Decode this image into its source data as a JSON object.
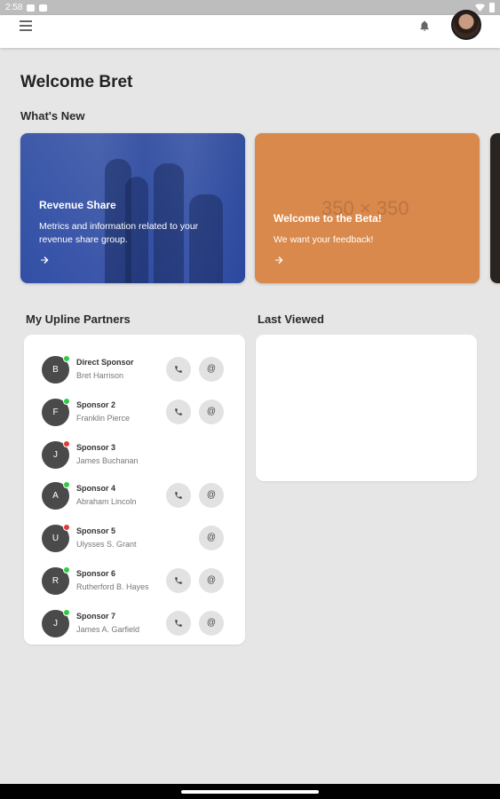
{
  "status_bar": {
    "time": "2:58"
  },
  "app_bar": {
    "menu_icon": "menu-icon",
    "notification_icon": "bell-icon",
    "profile_icon": "avatar"
  },
  "welcome": "Welcome Bret",
  "whats_new": {
    "title": "What's New",
    "cards": [
      {
        "title": "Revenue Share",
        "description": "Metrics and information related to your revenue share group.",
        "icon": "arrow-right-icon"
      },
      {
        "title": "Welcome to the Beta!",
        "description": "We want your feedback!",
        "placeholder": "350 × 350",
        "icon": "arrow-right-icon",
        "color": "#d9894c"
      }
    ]
  },
  "upline": {
    "title": "My Upline Partners",
    "partners": [
      {
        "initial": "B",
        "role": "Direct Sponsor",
        "name": "Bret Harrison",
        "status": "#2ecc40",
        "call": true,
        "email": true
      },
      {
        "initial": "F",
        "role": "Sponsor 2",
        "name": "Franklin Pierce",
        "status": "#2ecc40",
        "call": true,
        "email": true
      },
      {
        "initial": "J",
        "role": "Sponsor 3",
        "name": "James Buchanan",
        "status": "#e53935",
        "call": false,
        "email": false
      },
      {
        "initial": "A",
        "role": "Sponsor 4",
        "name": "Abraham Lincoln",
        "status": "#2ecc40",
        "call": true,
        "email": true
      },
      {
        "initial": "U",
        "role": "Sponsor 5",
        "name": "Ulysses S. Grant",
        "status": "#e53935",
        "call": false,
        "email": true
      },
      {
        "initial": "R",
        "role": "Sponsor 6",
        "name": "Rutherford B. Hayes",
        "status": "#2ecc40",
        "call": true,
        "email": true
      },
      {
        "initial": "J",
        "role": "Sponsor 7",
        "name": "James A. Garfield",
        "status": "#2ecc40",
        "call": true,
        "email": true
      }
    ]
  },
  "last_viewed": {
    "title": "Last Viewed"
  }
}
